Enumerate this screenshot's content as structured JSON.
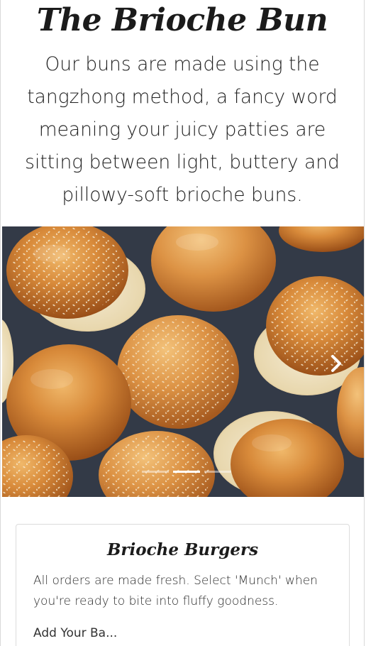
{
  "hero": {
    "title": "The Brioche Bun",
    "description": "Our buns are made using the tangzhong method, a fancy word meaning your juicy patties are sitting between light, buttery and pillowy-soft brioche buns."
  },
  "carousel": {
    "image_alt": "Golden brioche burger buns with sesame seeds on a dark surface",
    "next_icon": "chevron-right-icon",
    "slide_count": 3,
    "active_slide": 2
  },
  "card": {
    "title": "Brioche Burgers",
    "text": "All orders are made fresh. Select 'Munch' when you're ready to bite into fluffy goodness.",
    "next_line": "Add Your Ba..."
  },
  "colors": {
    "bun_crust": "#c7772c",
    "bun_light": "#e6a85a",
    "bun_crumb": "#efe2c4",
    "background_surface": "#2c3441"
  }
}
